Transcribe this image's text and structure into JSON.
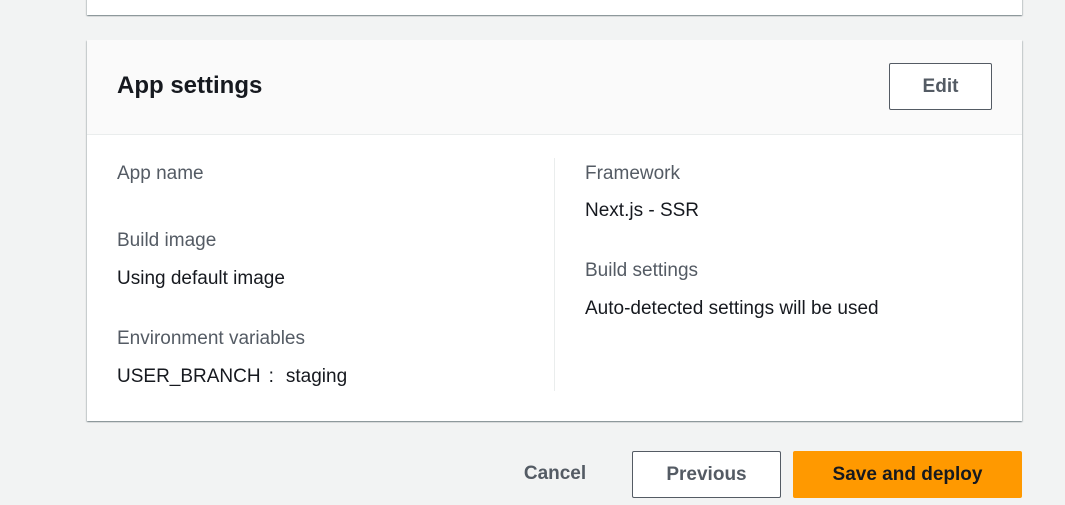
{
  "app_settings": {
    "title": "App settings",
    "edit_label": "Edit",
    "left_column": {
      "app_name_label": "App name",
      "app_name_value": "",
      "build_image_label": "Build image",
      "build_image_value": "Using default image",
      "env_vars_label": "Environment variables",
      "env_vars": [
        {
          "key": "USER_BRANCH",
          "separator": ":",
          "value": "staging"
        }
      ]
    },
    "right_column": {
      "framework_label": "Framework",
      "framework_value": "Next.js - SSR",
      "build_settings_label": "Build settings",
      "build_settings_value": "Auto-detected settings will be used"
    }
  },
  "footer": {
    "cancel_label": "Cancel",
    "previous_label": "Previous",
    "save_deploy_label": "Save and deploy"
  },
  "colors": {
    "page_background": "#f2f3f3",
    "primary_button": "#ff9900",
    "label_text": "#545b64",
    "value_text": "#16191f"
  }
}
